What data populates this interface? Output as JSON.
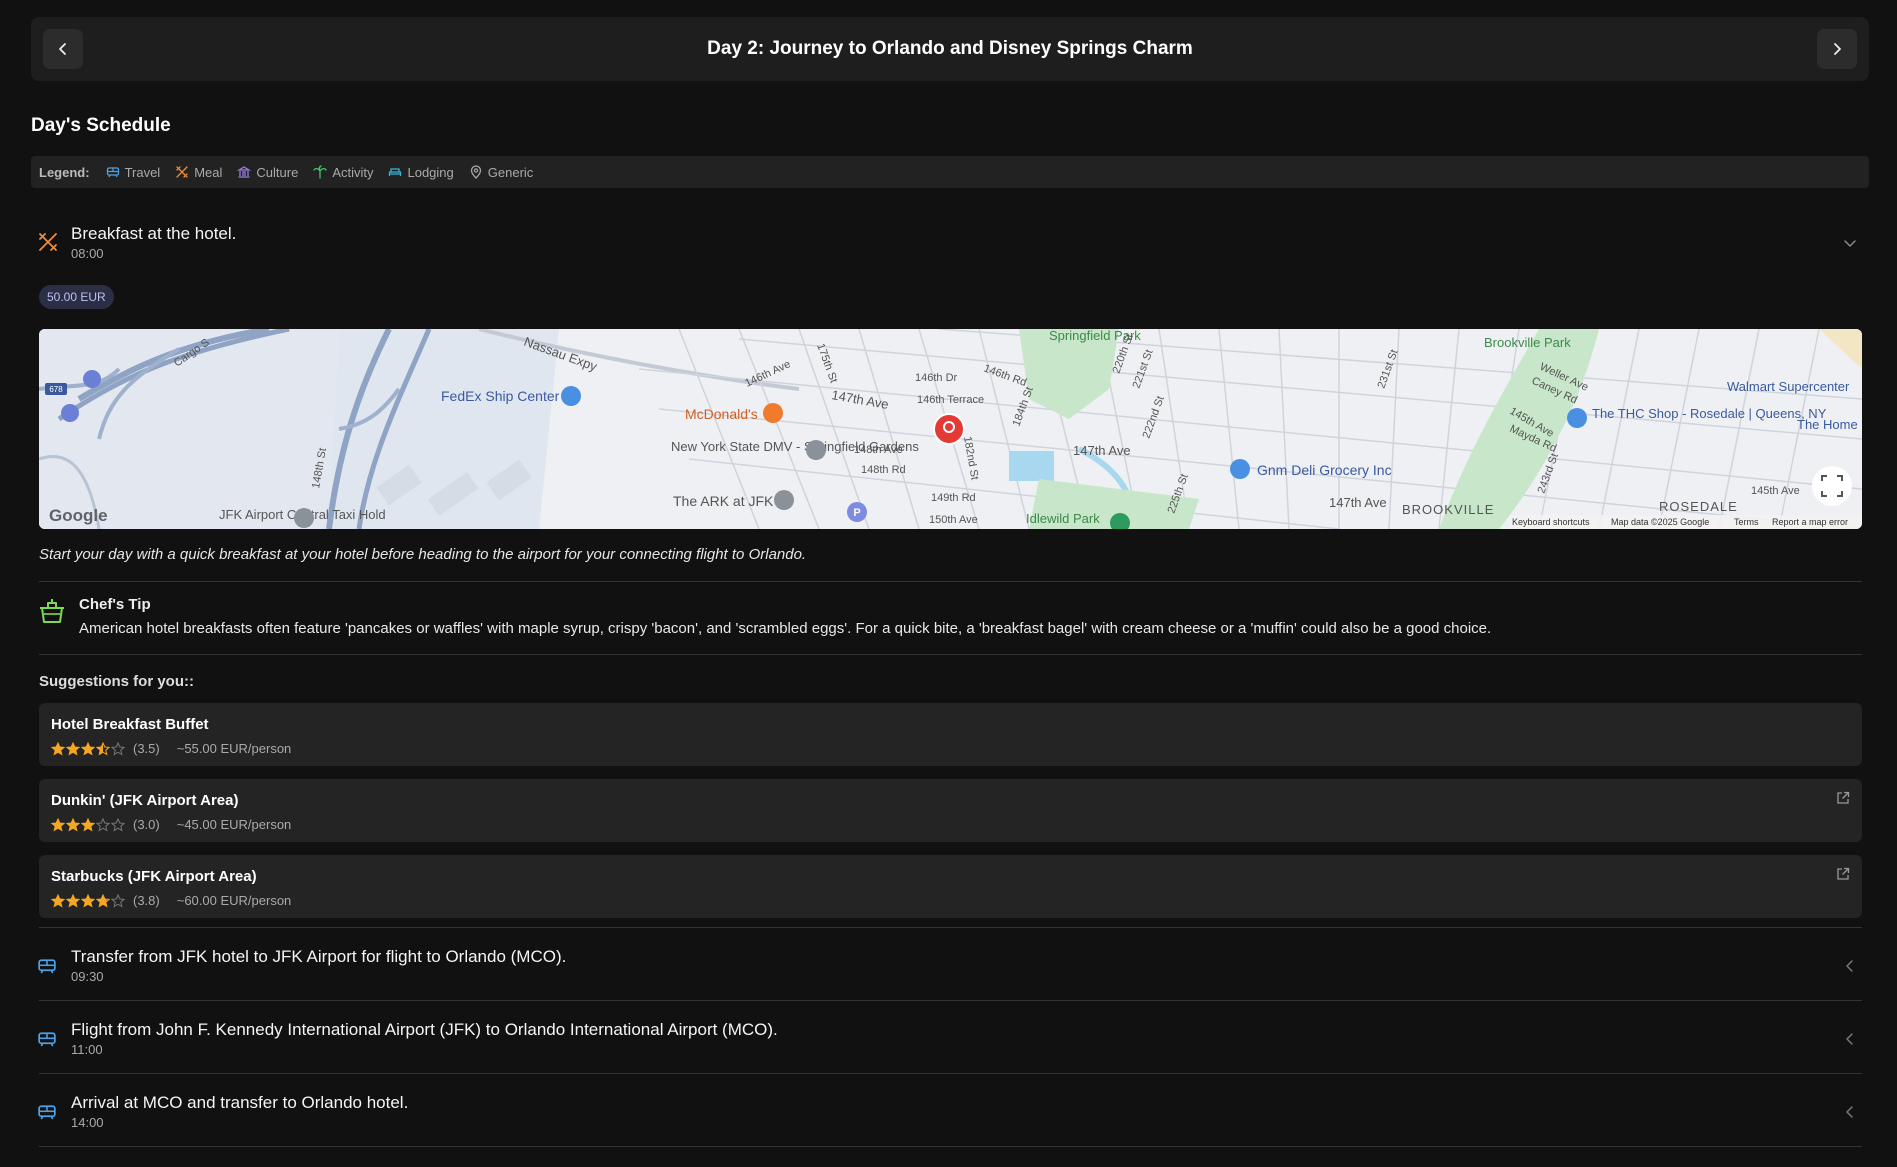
{
  "header": {
    "title": "Day 2: Journey to Orlando and Disney Springs Charm"
  },
  "schedule": {
    "title": "Day's Schedule",
    "legend": {
      "label": "Legend:",
      "items": [
        "Travel",
        "Meal",
        "Culture",
        "Activity",
        "Lodging",
        "Generic"
      ]
    }
  },
  "colors": {
    "travel": "#4aa3e8",
    "meal": "#f08a3c",
    "culture": "#9b7be8",
    "activity": "#4cc46a",
    "lodging": "#35b6d8",
    "generic": "#aaaaaa",
    "star": "#f5a623",
    "pill_bg": "#2a2f45"
  },
  "breakfast": {
    "title": "Breakfast at the hotel.",
    "time": "08:00",
    "price": "50.00 EUR",
    "icon": "meal-icon",
    "description": "Start your day with a quick breakfast at your hotel before heading to the airport for your connecting flight to Orlando.",
    "tip_title": "Chef's Tip",
    "tip_text": "American hotel breakfasts often feature 'pancakes or waffles' with maple syrup, crispy 'bacon', and 'scrambled eggs'. For a quick bite, a 'breakfast bagel' with cream cheese or a 'muffin' could also be a good choice.",
    "suggestions_title": "Suggestions for you::",
    "suggestions": [
      {
        "name": "Hotel Breakfast Buffet",
        "rating": 3.5,
        "rating_text": "(3.5)",
        "price": "~55.00 EUR/person",
        "has_link": false
      },
      {
        "name": "Dunkin' (JFK Airport Area)",
        "rating": 3.0,
        "rating_text": "(3.0)",
        "price": "~45.00 EUR/person",
        "has_link": true
      },
      {
        "name": "Starbucks (JFK Airport Area)",
        "rating": 3.8,
        "rating_text": "(3.8)",
        "price": "~60.00 EUR/person",
        "has_link": true
      }
    ]
  },
  "map": {
    "labels": {
      "springfield_park": "Springfield Park",
      "brookville_park": "Brookville Park",
      "nassau_expy": "Nassau Expy",
      "fedex": "FedEx Ship Center",
      "mcdonalds": "McDonald's",
      "dmv": "New York State DMV - Springfield Gardens",
      "ark": "The ARK at JFK",
      "jfk_taxi": "JFK Airport Central Taxi Hold",
      "gnm_deli": "Gnm Deli Grocery Inc",
      "thc_shop": "The THC Shop - Rosedale | Queens, NY",
      "walmart": "Walmart Supercenter",
      "the_home": "The Home",
      "brookville": "BROOKVILLE",
      "rosedale": "ROSEDALE",
      "idlewild": "Idlewild Park",
      "ave_147": "147th Ave",
      "ave_147b": "147th Ave",
      "ave_147c": "147th Ave",
      "ave_145": "145th Ave",
      "st_148": "148th St",
      "st_175": "175th St",
      "st_182": "182nd St",
      "st_184": "184th St",
      "st_220": "220th St",
      "st_221": "221st St",
      "st_222": "222nd St",
      "st_225": "225th St",
      "st_231": "231st St",
      "st_243": "243rd St",
      "dr_146": "146th Dr",
      "rd_146": "146th Rd",
      "terrace_146": "146th Terrace",
      "ave_146": "146th Ave",
      "ave_148": "148th Ave",
      "rd_148": "148th Rd",
      "rd_149": "149th Rd",
      "ave_150": "150th Ave",
      "weller": "Weller Ave",
      "caney": "Caney Rd",
      "mayda": "Mayda Rd",
      "ave_145b": "145th Ave",
      "cargo": "Cargo S",
      "shield": "678",
      "parking": "P",
      "google": "Google",
      "keyboard": "Keyboard shortcuts",
      "map_data": "Map data ©2025 Google",
      "terms": "Terms",
      "report": "Report a map error"
    }
  },
  "events": [
    {
      "title": "Transfer from JFK hotel to JFK Airport for flight to Orlando (MCO).",
      "time": "09:30",
      "icon": "transit-icon"
    },
    {
      "title": "Flight from John F. Kennedy International Airport (JFK) to Orlando International Airport (MCO).",
      "time": "11:00",
      "icon": "transit-icon"
    },
    {
      "title": "Arrival at MCO and transfer to Orlando hotel.",
      "time": "14:00",
      "icon": "transit-icon"
    }
  ]
}
